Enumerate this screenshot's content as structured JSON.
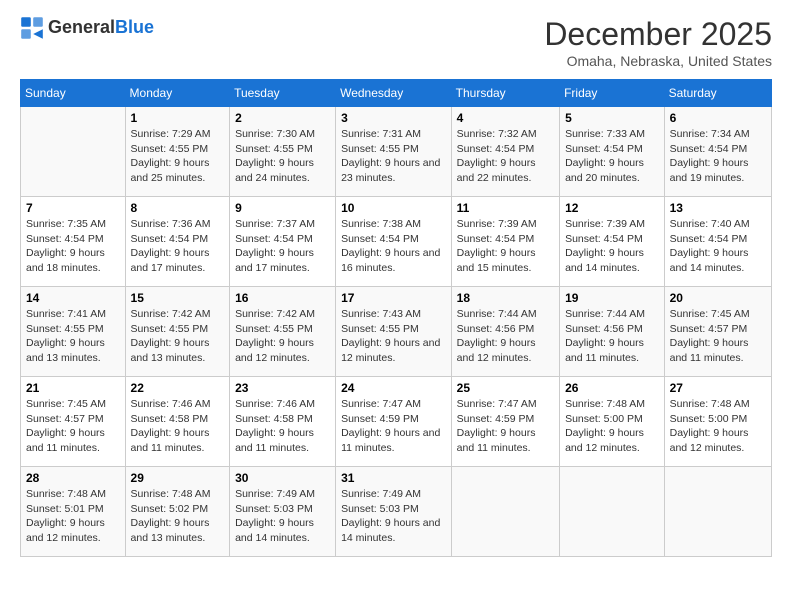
{
  "header": {
    "logo_general": "General",
    "logo_blue": "Blue",
    "title": "December 2025",
    "subtitle": "Omaha, Nebraska, United States"
  },
  "days_of_week": [
    "Sunday",
    "Monday",
    "Tuesday",
    "Wednesday",
    "Thursday",
    "Friday",
    "Saturday"
  ],
  "weeks": [
    [
      {
        "day": "",
        "sunrise": "",
        "sunset": "",
        "daylight": ""
      },
      {
        "day": "1",
        "sunrise": "Sunrise: 7:29 AM",
        "sunset": "Sunset: 4:55 PM",
        "daylight": "Daylight: 9 hours and 25 minutes."
      },
      {
        "day": "2",
        "sunrise": "Sunrise: 7:30 AM",
        "sunset": "Sunset: 4:55 PM",
        "daylight": "Daylight: 9 hours and 24 minutes."
      },
      {
        "day": "3",
        "sunrise": "Sunrise: 7:31 AM",
        "sunset": "Sunset: 4:55 PM",
        "daylight": "Daylight: 9 hours and 23 minutes."
      },
      {
        "day": "4",
        "sunrise": "Sunrise: 7:32 AM",
        "sunset": "Sunset: 4:54 PM",
        "daylight": "Daylight: 9 hours and 22 minutes."
      },
      {
        "day": "5",
        "sunrise": "Sunrise: 7:33 AM",
        "sunset": "Sunset: 4:54 PM",
        "daylight": "Daylight: 9 hours and 20 minutes."
      },
      {
        "day": "6",
        "sunrise": "Sunrise: 7:34 AM",
        "sunset": "Sunset: 4:54 PM",
        "daylight": "Daylight: 9 hours and 19 minutes."
      }
    ],
    [
      {
        "day": "7",
        "sunrise": "Sunrise: 7:35 AM",
        "sunset": "Sunset: 4:54 PM",
        "daylight": "Daylight: 9 hours and 18 minutes."
      },
      {
        "day": "8",
        "sunrise": "Sunrise: 7:36 AM",
        "sunset": "Sunset: 4:54 PM",
        "daylight": "Daylight: 9 hours and 17 minutes."
      },
      {
        "day": "9",
        "sunrise": "Sunrise: 7:37 AM",
        "sunset": "Sunset: 4:54 PM",
        "daylight": "Daylight: 9 hours and 17 minutes."
      },
      {
        "day": "10",
        "sunrise": "Sunrise: 7:38 AM",
        "sunset": "Sunset: 4:54 PM",
        "daylight": "Daylight: 9 hours and 16 minutes."
      },
      {
        "day": "11",
        "sunrise": "Sunrise: 7:39 AM",
        "sunset": "Sunset: 4:54 PM",
        "daylight": "Daylight: 9 hours and 15 minutes."
      },
      {
        "day": "12",
        "sunrise": "Sunrise: 7:39 AM",
        "sunset": "Sunset: 4:54 PM",
        "daylight": "Daylight: 9 hours and 14 minutes."
      },
      {
        "day": "13",
        "sunrise": "Sunrise: 7:40 AM",
        "sunset": "Sunset: 4:54 PM",
        "daylight": "Daylight: 9 hours and 14 minutes."
      }
    ],
    [
      {
        "day": "14",
        "sunrise": "Sunrise: 7:41 AM",
        "sunset": "Sunset: 4:55 PM",
        "daylight": "Daylight: 9 hours and 13 minutes."
      },
      {
        "day": "15",
        "sunrise": "Sunrise: 7:42 AM",
        "sunset": "Sunset: 4:55 PM",
        "daylight": "Daylight: 9 hours and 13 minutes."
      },
      {
        "day": "16",
        "sunrise": "Sunrise: 7:42 AM",
        "sunset": "Sunset: 4:55 PM",
        "daylight": "Daylight: 9 hours and 12 minutes."
      },
      {
        "day": "17",
        "sunrise": "Sunrise: 7:43 AM",
        "sunset": "Sunset: 4:55 PM",
        "daylight": "Daylight: 9 hours and 12 minutes."
      },
      {
        "day": "18",
        "sunrise": "Sunrise: 7:44 AM",
        "sunset": "Sunset: 4:56 PM",
        "daylight": "Daylight: 9 hours and 12 minutes."
      },
      {
        "day": "19",
        "sunrise": "Sunrise: 7:44 AM",
        "sunset": "Sunset: 4:56 PM",
        "daylight": "Daylight: 9 hours and 11 minutes."
      },
      {
        "day": "20",
        "sunrise": "Sunrise: 7:45 AM",
        "sunset": "Sunset: 4:57 PM",
        "daylight": "Daylight: 9 hours and 11 minutes."
      }
    ],
    [
      {
        "day": "21",
        "sunrise": "Sunrise: 7:45 AM",
        "sunset": "Sunset: 4:57 PM",
        "daylight": "Daylight: 9 hours and 11 minutes."
      },
      {
        "day": "22",
        "sunrise": "Sunrise: 7:46 AM",
        "sunset": "Sunset: 4:58 PM",
        "daylight": "Daylight: 9 hours and 11 minutes."
      },
      {
        "day": "23",
        "sunrise": "Sunrise: 7:46 AM",
        "sunset": "Sunset: 4:58 PM",
        "daylight": "Daylight: 9 hours and 11 minutes."
      },
      {
        "day": "24",
        "sunrise": "Sunrise: 7:47 AM",
        "sunset": "Sunset: 4:59 PM",
        "daylight": "Daylight: 9 hours and 11 minutes."
      },
      {
        "day": "25",
        "sunrise": "Sunrise: 7:47 AM",
        "sunset": "Sunset: 4:59 PM",
        "daylight": "Daylight: 9 hours and 11 minutes."
      },
      {
        "day": "26",
        "sunrise": "Sunrise: 7:48 AM",
        "sunset": "Sunset: 5:00 PM",
        "daylight": "Daylight: 9 hours and 12 minutes."
      },
      {
        "day": "27",
        "sunrise": "Sunrise: 7:48 AM",
        "sunset": "Sunset: 5:00 PM",
        "daylight": "Daylight: 9 hours and 12 minutes."
      }
    ],
    [
      {
        "day": "28",
        "sunrise": "Sunrise: 7:48 AM",
        "sunset": "Sunset: 5:01 PM",
        "daylight": "Daylight: 9 hours and 12 minutes."
      },
      {
        "day": "29",
        "sunrise": "Sunrise: 7:48 AM",
        "sunset": "Sunset: 5:02 PM",
        "daylight": "Daylight: 9 hours and 13 minutes."
      },
      {
        "day": "30",
        "sunrise": "Sunrise: 7:49 AM",
        "sunset": "Sunset: 5:03 PM",
        "daylight": "Daylight: 9 hours and 14 minutes."
      },
      {
        "day": "31",
        "sunrise": "Sunrise: 7:49 AM",
        "sunset": "Sunset: 5:03 PM",
        "daylight": "Daylight: 9 hours and 14 minutes."
      },
      {
        "day": "",
        "sunrise": "",
        "sunset": "",
        "daylight": ""
      },
      {
        "day": "",
        "sunrise": "",
        "sunset": "",
        "daylight": ""
      },
      {
        "day": "",
        "sunrise": "",
        "sunset": "",
        "daylight": ""
      }
    ]
  ]
}
